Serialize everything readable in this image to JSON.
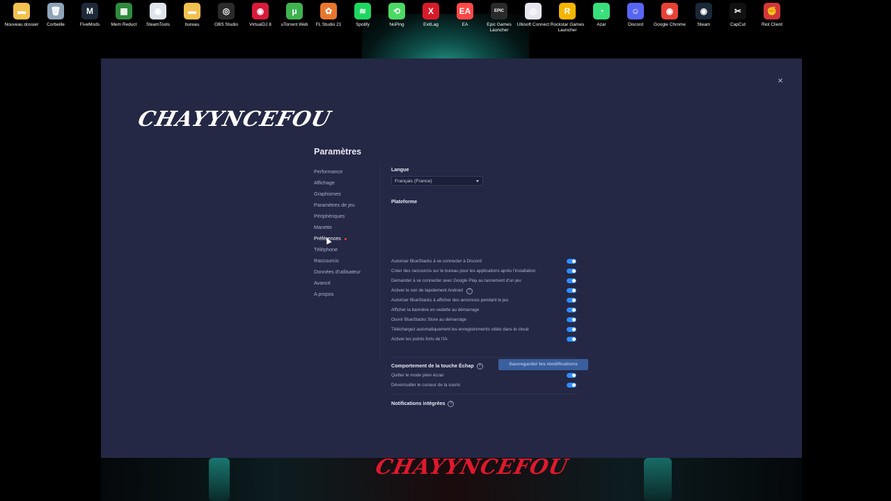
{
  "desktop": {
    "icons": [
      {
        "label": "Nouveau dossier",
        "color": "#f2c14e",
        "glyph": "▬",
        "x": 0
      },
      {
        "label": "Corbeille",
        "color": "#8ea4b8",
        "glyph": "🗑",
        "x": 1
      },
      {
        "label": "FiveMods",
        "color": "#1e2a3a",
        "glyph": "M",
        "x": 2
      },
      {
        "label": "Mem Reduct",
        "color": "#2e8b3e",
        "glyph": "▦",
        "x": 3
      },
      {
        "label": "SteamTools",
        "color": "#dfe3ea",
        "glyph": "◉",
        "x": 4
      },
      {
        "label": "bureau",
        "color": "#f2c14e",
        "glyph": "▬",
        "x": 5
      },
      {
        "label": "OBS Studio",
        "color": "#2b2b2b",
        "glyph": "◎",
        "x": 6
      },
      {
        "label": "VirtualDJ 8",
        "color": "#d81b3a",
        "glyph": "◉",
        "x": 7
      },
      {
        "label": "uTorrent Web",
        "color": "#3fb34f",
        "glyph": "μ",
        "x": 8
      },
      {
        "label": "FL Studio 21",
        "color": "#e8772e",
        "glyph": "✿",
        "x": 9
      },
      {
        "label": "Spotify",
        "color": "#1ed760",
        "glyph": "≋",
        "x": 10
      },
      {
        "label": "NoPing",
        "color": "#4cd964",
        "glyph": "⟲",
        "x": 11
      },
      {
        "label": "ExitLag",
        "color": "#d81b2a",
        "glyph": "X",
        "x": 12
      },
      {
        "label": "EA",
        "color": "#ff4747",
        "glyph": "EA",
        "x": 13
      },
      {
        "label": "Epic Games Launcher",
        "color": "#2a2a2a",
        "glyph": "EPIC",
        "x": 14
      },
      {
        "label": "Ubisoft Connect",
        "color": "#e6e6f0",
        "glyph": "◎",
        "x": 15
      },
      {
        "label": "Rockstar Games Launcher",
        "color": "#f4b500",
        "glyph": "R",
        "x": 16
      },
      {
        "label": "Azar",
        "color": "#38e07b",
        "glyph": "◔",
        "x": 17
      },
      {
        "label": "Discord",
        "color": "#5865f2",
        "glyph": "☺",
        "x": 18
      },
      {
        "label": "Google Chrome",
        "color": "#e94235",
        "glyph": "◉",
        "x": 19
      },
      {
        "label": "Steam",
        "color": "#1b2838",
        "glyph": "◉",
        "x": 20
      },
      {
        "label": "CapCut",
        "color": "#111111",
        "glyph": "✂",
        "x": 21
      },
      {
        "label": "Riot Client",
        "color": "#d13639",
        "glyph": "✊",
        "x": 22
      }
    ],
    "background_brand": "CHAYYNCEFOU"
  },
  "panel": {
    "close_glyph": "×",
    "brand_logo": "CHAYYNCEFOU",
    "title": "Paramètres",
    "nav": [
      {
        "label": "Performance"
      },
      {
        "label": "Affichage"
      },
      {
        "label": "Graphismes"
      },
      {
        "label": "Paramètres de jeu"
      },
      {
        "label": "Périphériques"
      },
      {
        "label": "Manette"
      },
      {
        "label": "Préférences",
        "active": true
      },
      {
        "label": "Téléphone"
      },
      {
        "label": "Raccourcis"
      },
      {
        "label": "Données d'utilisateur"
      },
      {
        "label": "Avancé"
      },
      {
        "label": "A propos"
      }
    ],
    "langue": {
      "label": "Langue",
      "value": "Français (France)"
    },
    "plateforme": {
      "label": "Plateforme",
      "options": [
        {
          "label": "Autoriser BlueStacks à se connecter à Discord",
          "on": true
        },
        {
          "label": "Créer des raccourcis sur le bureau pour les applications après l'installation",
          "on": true
        },
        {
          "label": "Demander à se connecter avec Google Play au lancement d'un jeu",
          "on": true
        },
        {
          "label": "Activer le son de tapotement Android",
          "on": true,
          "help": true
        },
        {
          "label": "Autoriser BlueStacks à afficher des annonces pendant le jeu",
          "on": true
        },
        {
          "label": "Afficher la bannière en vedette au démarrage",
          "on": true
        },
        {
          "label": "Ouvrir BlueStacks Store au démarrage",
          "on": true
        },
        {
          "label": "Téléchargez automatiquement les enregistrements vidéo dans le cloud",
          "on": true
        },
        {
          "label": "Activer les points forts de l'IA",
          "on": true
        }
      ]
    },
    "echap": {
      "label": "Comportement de la touche Échap",
      "options": [
        {
          "label": "Quitter le mode plein écran",
          "on": true
        },
        {
          "label": "Déverrouiller le curseur de la souris",
          "on": true
        }
      ]
    },
    "notifications": {
      "label": "Notifications intégrées"
    },
    "save_label": "Sauvegarder les modifications",
    "colors": {
      "panel_bg": "#242845",
      "toggle_on": "#2f8cff",
      "save_button": "#3a5f9e",
      "active_dot": "#ff3b30"
    }
  }
}
